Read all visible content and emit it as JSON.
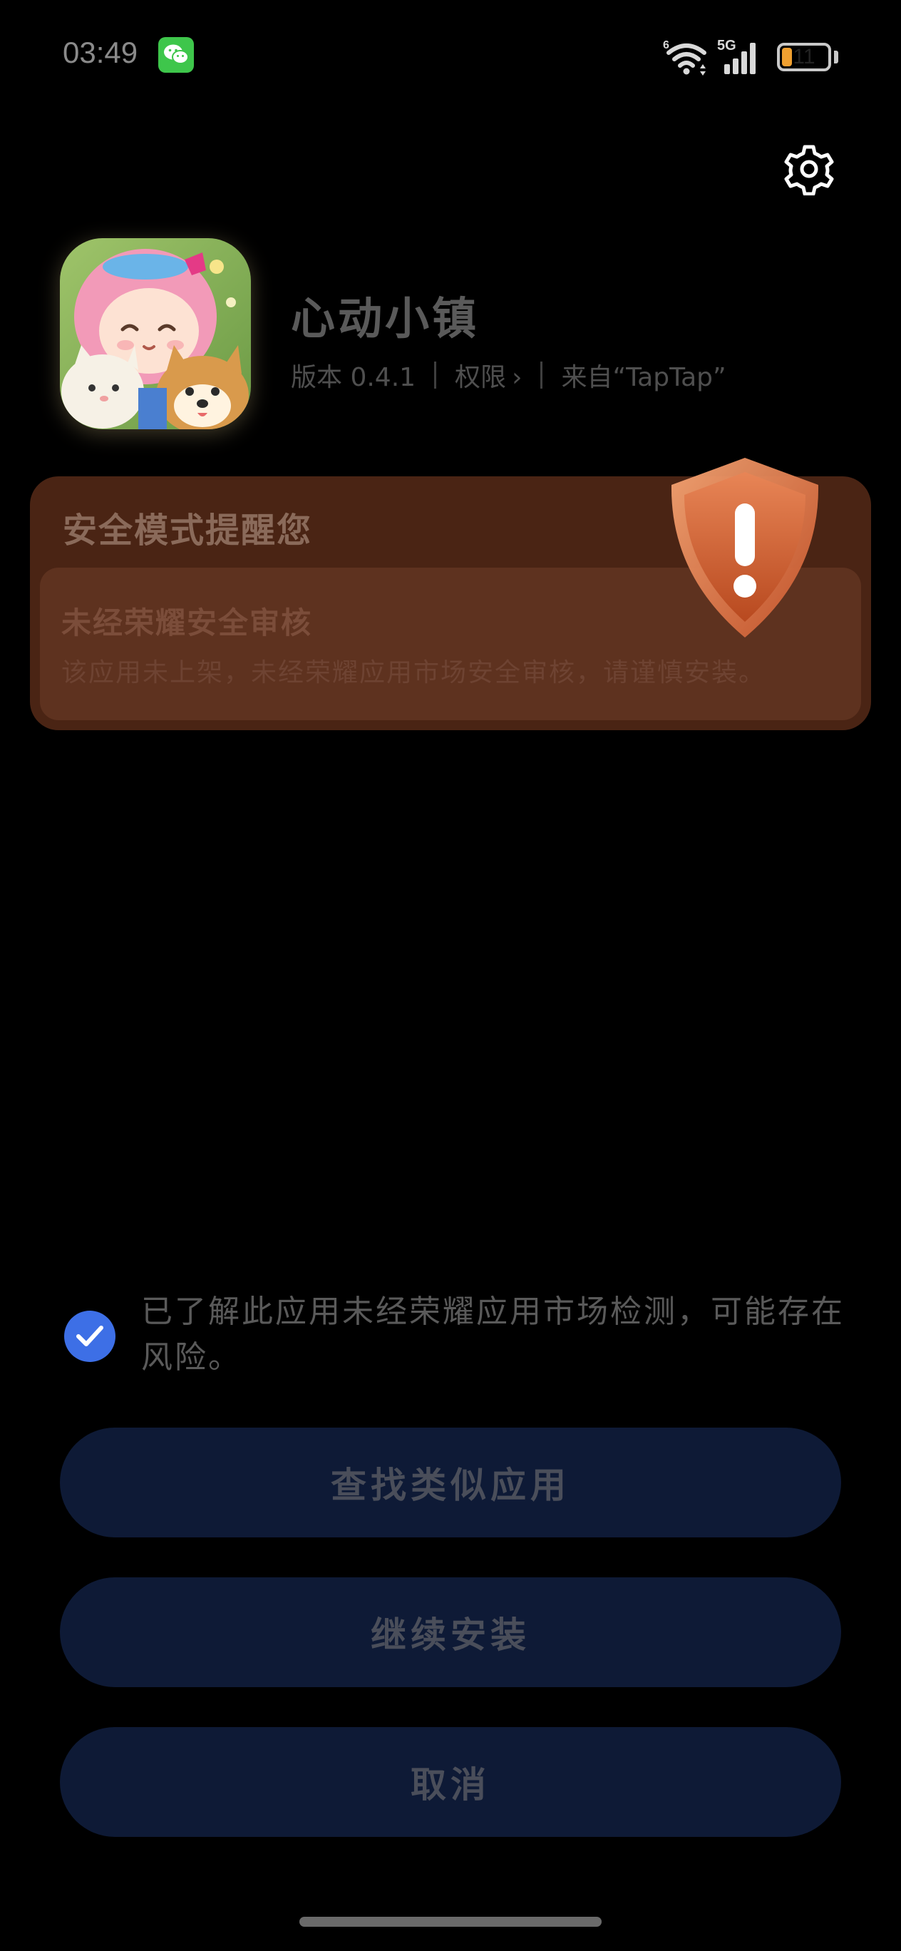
{
  "status_bar": {
    "time": "03:49",
    "network_label": "5G",
    "wifi_label": "6",
    "battery_level": "11",
    "wechat_icon": "wechat-icon"
  },
  "app": {
    "name": "心动小镇",
    "version": "版本 0.4.1",
    "permissions_label": "权限",
    "source": "来自“TapTap”"
  },
  "warning_card": {
    "title": "安全模式提醒您",
    "subtitle": "未经荣耀安全审核",
    "description": "该应用未上架，未经荣耀应用市场安全审核，请谨慎安装。",
    "background_color": "#4a2414",
    "accent_color": "#e8753a"
  },
  "consent": {
    "checked": true,
    "text": "已了解此应用未经荣耀应用市场检测，可能存在风险。"
  },
  "buttons": {
    "find_similar": "查找类似应用",
    "continue_install": "继续安装",
    "cancel": "取消"
  },
  "colors": {
    "background": "#000000",
    "button_bg": "#0e1a36",
    "check_blue": "#3d6fe6"
  }
}
